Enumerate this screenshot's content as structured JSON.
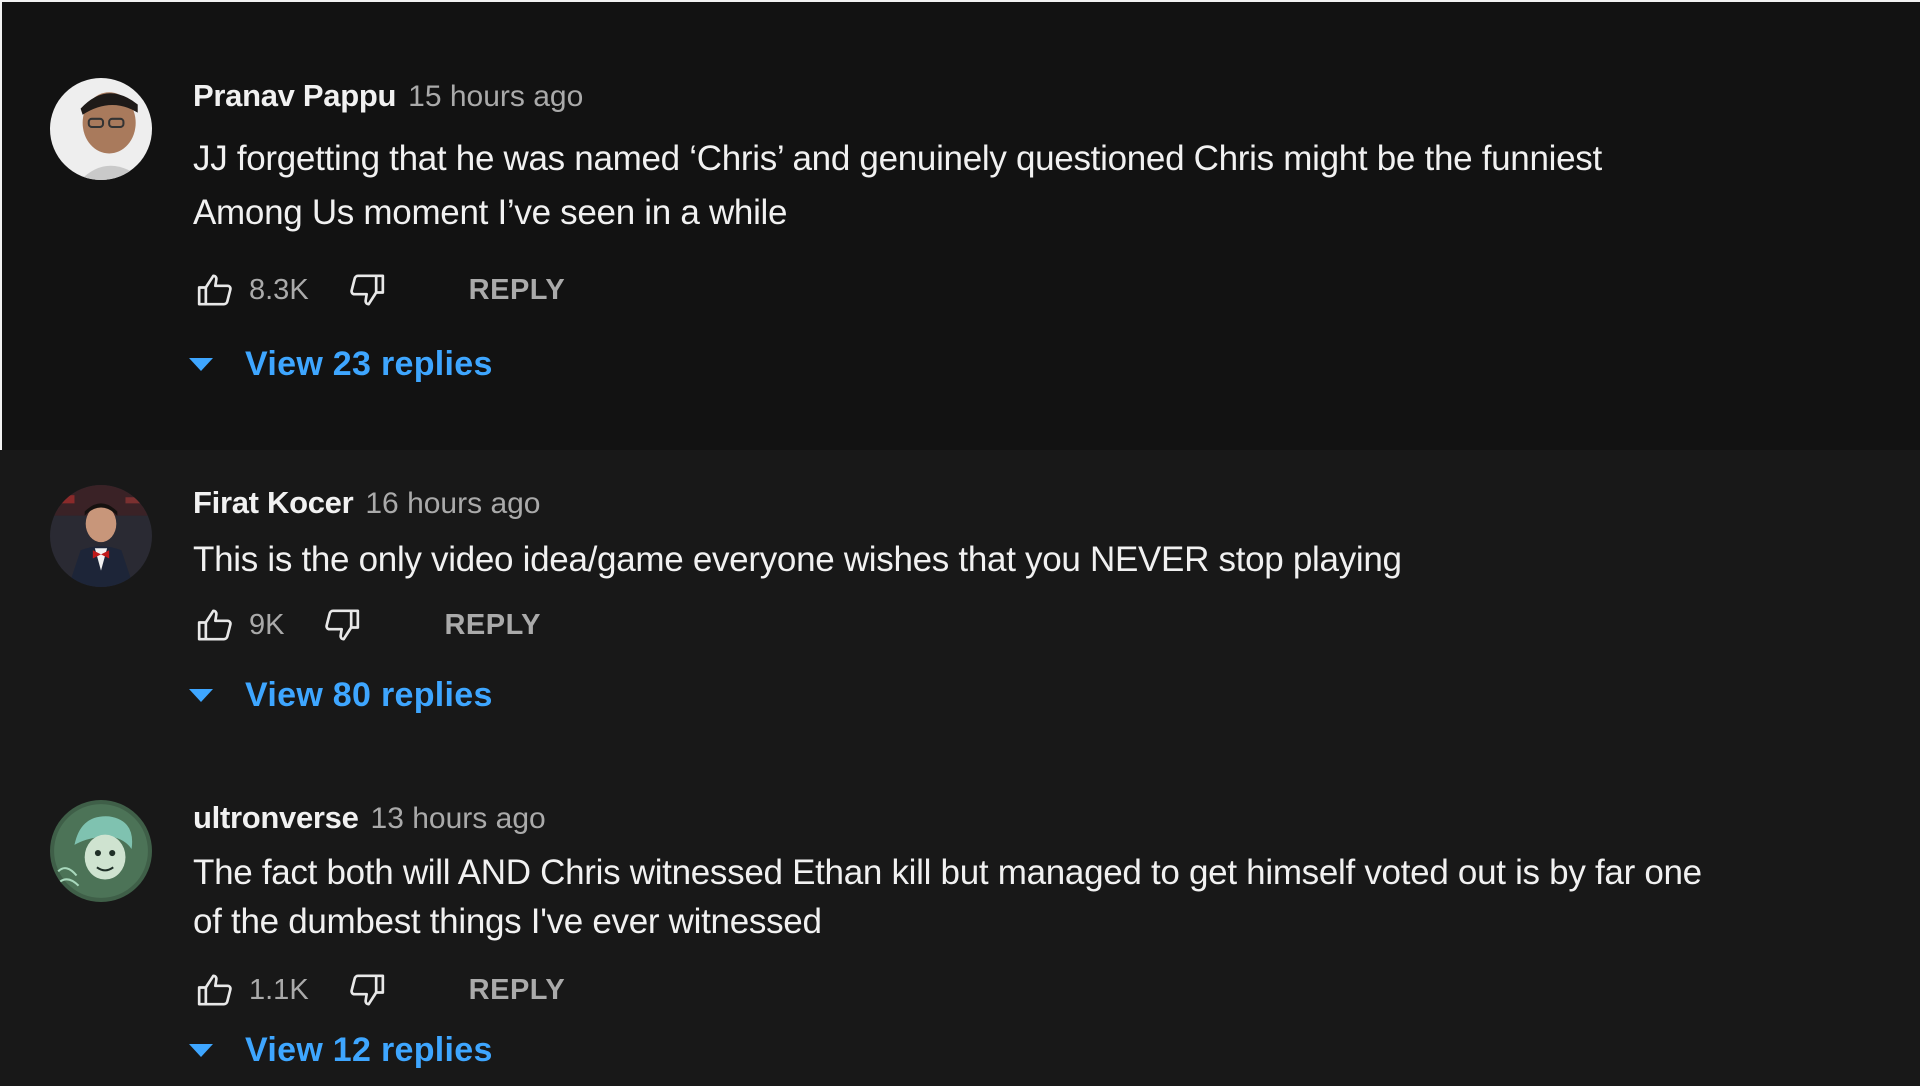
{
  "colors": {
    "background": "#181818",
    "text_primary": "#f1f1f1",
    "text_secondary": "#aaaaaa",
    "link_blue": "#3ea6ff"
  },
  "comments": [
    {
      "author": "Pranav Pappu",
      "time": "15 hours ago",
      "text_lines": [
        "JJ forgetting that he was named ‘Chris’ and genuinely questioned Chris might be the funniest",
        "Among Us moment I’ve seen in a while"
      ],
      "likes": "8.3K",
      "like_icon": "thumbs-up-icon",
      "dislike_icon": "thumbs-down-icon",
      "reply_label": "REPLY",
      "view_replies": "View 23 replies",
      "expand_icon": "caret-down-icon"
    },
    {
      "author": "Firat Kocer",
      "time": "16 hours ago",
      "text_lines": [
        "This is the only video idea/game everyone wishes that you NEVER stop playing"
      ],
      "likes": "9K",
      "like_icon": "thumbs-up-icon",
      "dislike_icon": "thumbs-down-icon",
      "reply_label": "REPLY",
      "view_replies": "View 80 replies",
      "expand_icon": "caret-down-icon"
    },
    {
      "author": "ultronverse",
      "time": "13 hours ago",
      "text_lines": [
        "The fact both will AND Chris witnessed Ethan kill but managed to get himself voted out is by far one",
        "of the dumbest things I've ever witnessed"
      ],
      "likes": "1.1K",
      "like_icon": "thumbs-up-icon",
      "dislike_icon": "thumbs-down-icon",
      "reply_label": "REPLY",
      "view_replies": "View 12 replies",
      "expand_icon": "caret-down-icon"
    }
  ]
}
